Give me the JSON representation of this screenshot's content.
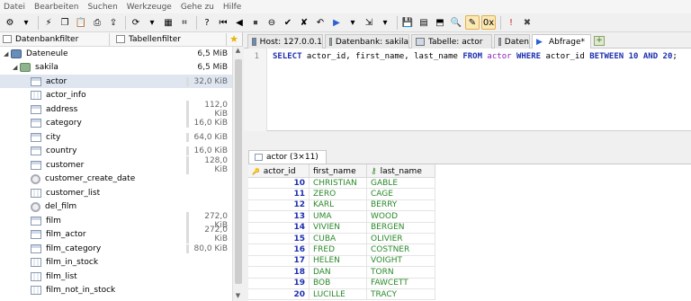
{
  "menu": [
    "Datei",
    "Bearbeiten",
    "Suchen",
    "Werkzeuge",
    "Gehe zu",
    "Hilfe"
  ],
  "toolbar_icons": [
    "session-manager-icon",
    "session-arrow-icon",
    "connect-icon",
    "copy-icon",
    "paste-icon",
    "print-icon",
    "export-icon",
    "refresh-icon",
    "refresh-arrow-icon",
    "table-icon",
    "filter-icon",
    "help-icon",
    "first-record-icon",
    "prev-record-icon",
    "stop-icon",
    "delete-icon",
    "post-icon",
    "cancel-icon",
    "undo-icon",
    "run-icon",
    "run-arrow-icon",
    "run-line-icon",
    "run-line-arrow-icon",
    "save-icon",
    "save-snippet-icon",
    "load-icon",
    "find-icon",
    "edit-icon",
    "binary-icon",
    "explain-icon",
    "close-icon"
  ],
  "filters": {
    "database": "Datenbankfilter",
    "table": "Tabellenfilter"
  },
  "tree": [
    {
      "name": "Dateneule",
      "size": "6,5 MiB",
      "kind": "host",
      "level": 0,
      "arrow": "◢",
      "plain": true
    },
    {
      "name": "sakila",
      "size": "6,5 MiB",
      "kind": "db",
      "level": 1,
      "arrow": "◢",
      "plain": true
    },
    {
      "name": "actor",
      "size": "32,0 KiB",
      "kind": "table",
      "level": 2,
      "selected": true
    },
    {
      "name": "actor_info",
      "size": "",
      "kind": "view",
      "level": 2
    },
    {
      "name": "address",
      "size": "112,0 KiB",
      "kind": "table",
      "level": 2
    },
    {
      "name": "category",
      "size": "16,0 KiB",
      "kind": "table",
      "level": 2
    },
    {
      "name": "city",
      "size": "64,0 KiB",
      "kind": "table",
      "level": 2
    },
    {
      "name": "country",
      "size": "16,0 KiB",
      "kind": "table",
      "level": 2
    },
    {
      "name": "customer",
      "size": "128,0 KiB",
      "kind": "table",
      "level": 2
    },
    {
      "name": "customer_create_date",
      "size": "",
      "kind": "gear",
      "level": 2
    },
    {
      "name": "customer_list",
      "size": "",
      "kind": "view",
      "level": 2
    },
    {
      "name": "del_film",
      "size": "",
      "kind": "gear",
      "level": 2
    },
    {
      "name": "film",
      "size": "272,0 KiB",
      "kind": "table",
      "level": 2
    },
    {
      "name": "film_actor",
      "size": "272,0 KiB",
      "kind": "table",
      "level": 2
    },
    {
      "name": "film_category",
      "size": "80,0 KiB",
      "kind": "table",
      "level": 2
    },
    {
      "name": "film_in_stock",
      "size": "",
      "kind": "view",
      "level": 2
    },
    {
      "name": "film_list",
      "size": "",
      "kind": "view",
      "level": 2
    },
    {
      "name": "film_not_in_stock",
      "size": "",
      "kind": "view",
      "level": 2
    }
  ],
  "tabs": [
    {
      "label": "Host: 127.0.0.1",
      "icon": "host-icon"
    },
    {
      "label": "Datenbank: sakila",
      "icon": "database-icon"
    },
    {
      "label": "Tabelle: actor",
      "icon": "table-icon"
    },
    {
      "label": "Daten",
      "icon": "data-icon"
    },
    {
      "label": "Abfrage*",
      "icon": "query-icon",
      "active": true
    }
  ],
  "editor": {
    "line_number": "1",
    "sql": {
      "kw_select": "SELECT",
      "cols": " actor_id, first_name, last_name ",
      "kw_from": "FROM",
      "table": " actor ",
      "kw_where": "WHERE",
      "col_where": " actor_id ",
      "kw_between": "BETWEEN",
      "n1": " 10 ",
      "kw_and": "AND",
      "n2": " 20",
      "end": ";"
    }
  },
  "result": {
    "tab_label": "actor (3×11)",
    "columns": [
      "actor_id",
      "first_name",
      "last_name"
    ],
    "rows": [
      [
        "10",
        "CHRISTIAN",
        "GABLE"
      ],
      [
        "11",
        "ZERO",
        "CAGE"
      ],
      [
        "12",
        "KARL",
        "BERRY"
      ],
      [
        "13",
        "UMA",
        "WOOD"
      ],
      [
        "14",
        "VIVIEN",
        "BERGEN"
      ],
      [
        "15",
        "CUBA",
        "OLIVIER"
      ],
      [
        "16",
        "FRED",
        "COSTNER"
      ],
      [
        "17",
        "HELEN",
        "VOIGHT"
      ],
      [
        "18",
        "DAN",
        "TORN"
      ],
      [
        "19",
        "BOB",
        "FAWCETT"
      ],
      [
        "20",
        "LUCILLE",
        "TRACY"
      ]
    ]
  },
  "colors": {
    "keyword": "#1d2fb0",
    "table_name": "#8a1fb8",
    "text_value": "#2a8a2a",
    "selection": "#dfe6f0"
  }
}
